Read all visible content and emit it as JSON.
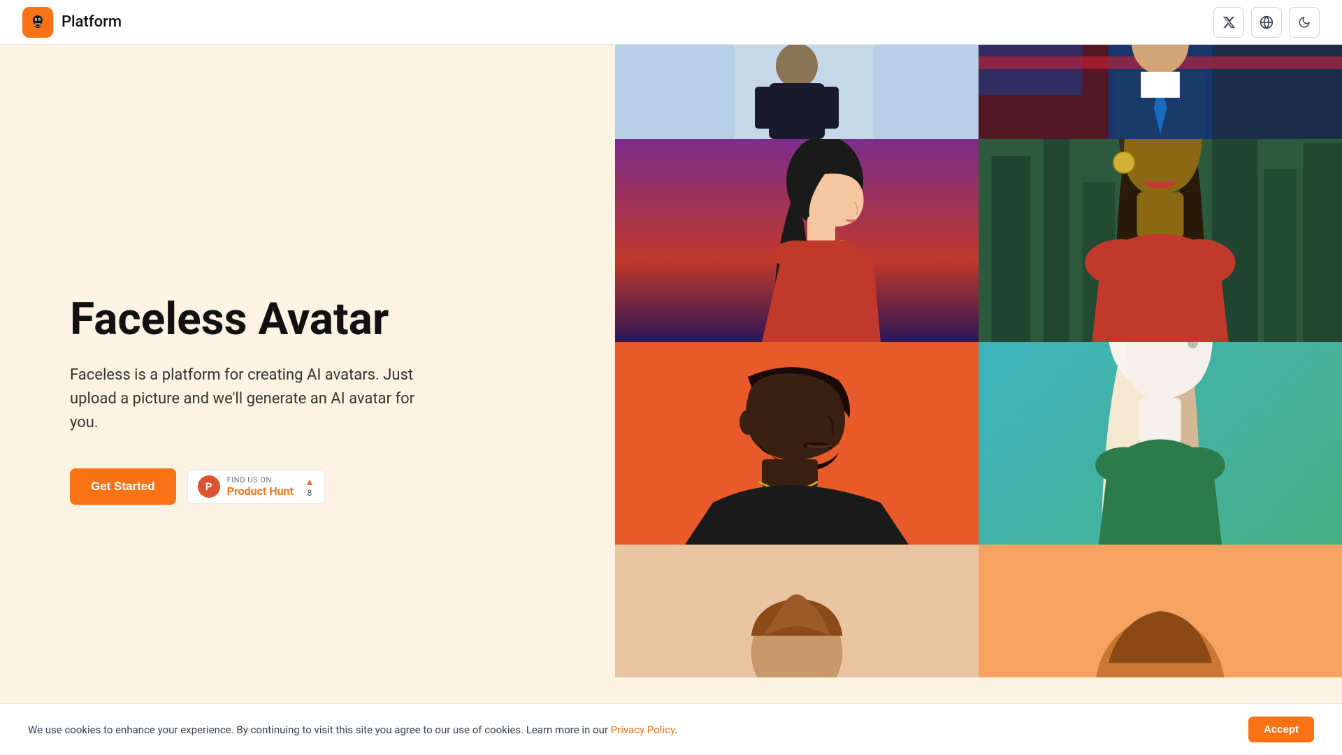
{
  "nav": {
    "logo_icon": "🤖",
    "title": "Platform",
    "twitter_icon": "✕",
    "globe_icon": "🌐",
    "moon_icon": "☾"
  },
  "hero": {
    "title": "Faceless Avatar",
    "description": "Faceless is a platform for creating AI avatars. Just upload a picture and we'll generate an AI avatar for you.",
    "cta_label": "Get Started",
    "product_hunt": {
      "find_label": "FIND US ON",
      "name": "Product Hunt",
      "upvote_icon": "▲",
      "upvote_count": "8"
    }
  },
  "gallery": {
    "cells": [
      {
        "id": "cell-1",
        "bg": "#b8d4e8",
        "desc": "person in dark jacket"
      },
      {
        "id": "cell-2",
        "bg": "#1a2e4a",
        "desc": "person in suit with flag"
      },
      {
        "id": "cell-3",
        "bg": "purple-red-gradient",
        "desc": "woman side profile red dress"
      },
      {
        "id": "cell-4",
        "bg": "#2d5a3d",
        "desc": "woman in city red dress"
      },
      {
        "id": "cell-5",
        "bg": "#e85a2a",
        "desc": "man with beard chain"
      },
      {
        "id": "cell-6",
        "bg": "teal-green-gradient",
        "desc": "woman long hair white silhouette"
      },
      {
        "id": "cell-7",
        "bg": "#e8a87c",
        "desc": "partial figure"
      },
      {
        "id": "cell-8",
        "bg": "#f4a460",
        "desc": "partial figure orange"
      }
    ]
  },
  "cookie": {
    "text": "We use cookies to enhance your experience. By continuing to visit this site you agree to our use of cookies. Learn more in our ",
    "link_text": "Privacy Policy",
    "accept_label": "Accept"
  }
}
